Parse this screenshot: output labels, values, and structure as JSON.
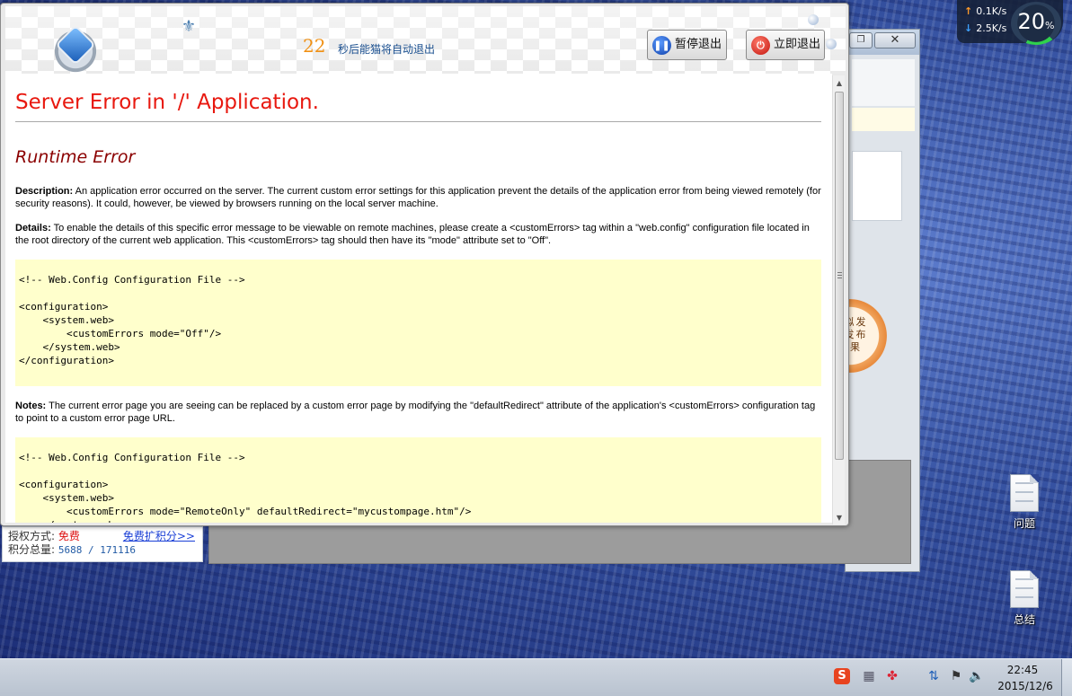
{
  "popup": {
    "countdown_number": "22",
    "countdown_text": "秒后能猫将自动退出",
    "pause_button": "暂停退出",
    "exit_button": "立即退出"
  },
  "error_page": {
    "title": "Server Error in '/' Application.",
    "subtitle": "Runtime Error",
    "description_label": "Description:",
    "description_text": "An application error occurred on the server. The current custom error settings for this application prevent the details of the application error from being viewed remotely (for security reasons). It could, however, be viewed by browsers running on the local server machine.",
    "details_label": "Details:",
    "details_text": "To enable the details of this specific error message to be viewable on remote machines, please create a <customErrors> tag within a \"web.config\" configuration file located in the root directory of the current web application. This <customErrors> tag should then have its \"mode\" attribute set to \"Off\".",
    "code_block_1": "<!-- Web.Config Configuration File -->\n\n<configuration>\n    <system.web>\n        <customErrors mode=\"Off\"/>\n    </system.web>\n</configuration>",
    "notes_label": "Notes:",
    "notes_text": "The current error page you are seeing can be replaced by a custom error page by modifying the \"defaultRedirect\" attribute of the application's <customErrors> configuration tag to point to a custom error page URL.",
    "code_block_2": "<!-- Web.Config Configuration File -->\n\n<configuration>\n    <system.web>\n        <customErrors mode=\"RemoteOnly\" defaultRedirect=\"mycustompage.htm\"/>\n    </system.web>"
  },
  "background_app": {
    "license_label": "授权方式:",
    "license_value": "免费",
    "expand_link": "免费扩积分>>",
    "points_label": "积分总量:",
    "points_value": "5688 / 171116",
    "badge_text": "模拟发\n布发布\n结果"
  },
  "net_widget": {
    "upload": "0.1K/s",
    "download": "2.5K/s",
    "cpu_value": "20",
    "cpu_unit": "%"
  },
  "desktop_icons": [
    {
      "label": "问题"
    },
    {
      "label": "总结"
    }
  ],
  "taskbar": {
    "time": "22:45",
    "date": "2015/12/6"
  },
  "colors": {
    "error_title": "#e8180f",
    "error_subtitle": "#8b0000",
    "code_background": "#ffffcc",
    "countdown": "#f09013",
    "desktop": "#2a3f8a"
  },
  "icons": {
    "pause": "pause-icon",
    "power": "power-icon",
    "app_logo": "app-logo-icon",
    "document": "document-icon"
  }
}
